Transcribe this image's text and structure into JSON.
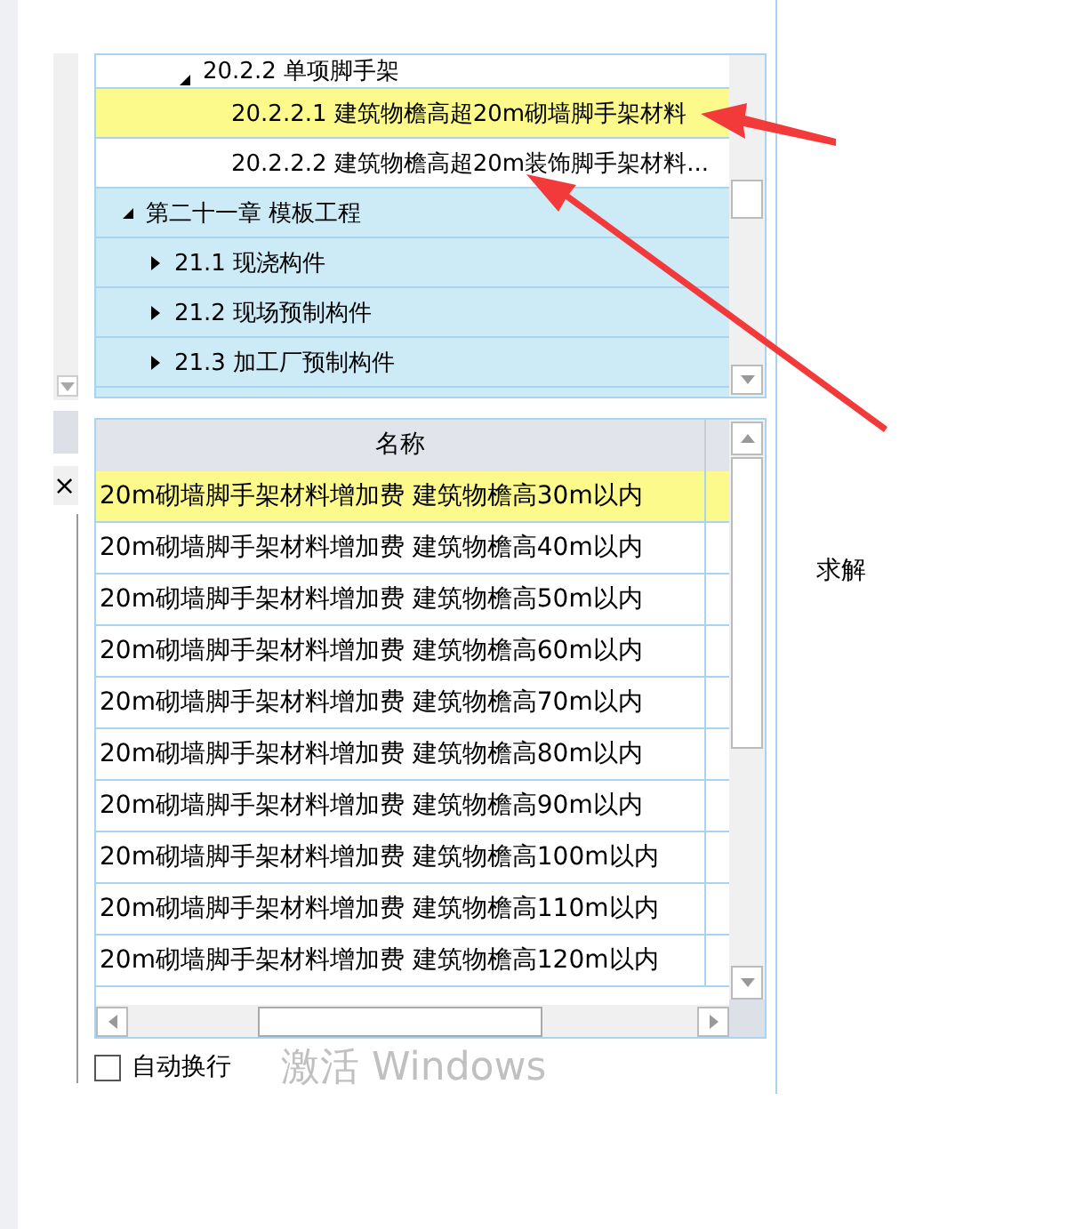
{
  "side": {
    "close": "×"
  },
  "tree": {
    "nodes": [
      {
        "children": [
          {
            "children": [
              {
                "label": "20.2.2 单项脚手架",
                "expanded": true,
                "selected": false,
                "children": [
                  {
                    "label": "20.2.2.1 建筑物檐高超20m砌墙脚手架材料",
                    "selected": true
                  },
                  {
                    "label": "20.2.2.2 建筑物檐高超20m装饰脚手架材料...",
                    "selected": false
                  }
                ]
              }
            ]
          }
        ]
      },
      {
        "label": "第二十一章 模板工程",
        "expanded": true,
        "selected": false,
        "color": "#cdeaf7",
        "children": [
          {
            "label": "21.1 现浇构件",
            "expanded": false,
            "selected": false,
            "color": "#cdeaf7"
          },
          {
            "label": "21.2 现场预制构件",
            "expanded": false,
            "selected": false,
            "color": "#cdeaf7"
          },
          {
            "label": "21.3 加工厂预制构件",
            "expanded": false,
            "selected": false,
            "color": "#cdeaf7"
          }
        ]
      }
    ]
  },
  "table": {
    "columns": [
      "名称"
    ],
    "rows": [
      {
        "name": "20m砌墙脚手架材料增加费  建筑物檐高30m以内",
        "selected": true
      },
      {
        "name": "20m砌墙脚手架材料增加费  建筑物檐高40m以内",
        "selected": false
      },
      {
        "name": "20m砌墙脚手架材料增加费  建筑物檐高50m以内",
        "selected": false
      },
      {
        "name": "20m砌墙脚手架材料增加费  建筑物檐高60m以内",
        "selected": false
      },
      {
        "name": "20m砌墙脚手架材料增加费  建筑物檐高70m以内",
        "selected": false
      },
      {
        "name": "20m砌墙脚手架材料增加费  建筑物檐高80m以内",
        "selected": false
      },
      {
        "name": "20m砌墙脚手架材料增加费  建筑物檐高90m以内",
        "selected": false
      },
      {
        "name": "20m砌墙脚手架材料增加费  建筑物檐高100m以内",
        "selected": false
      },
      {
        "name": "20m砌墙脚手架材料增加费  建筑物檐高110m以内",
        "selected": false
      },
      {
        "name": "20m砌墙脚手架材料增加费  建筑物檐高120m以内",
        "selected": false
      }
    ]
  },
  "wrap_option": {
    "label": "自动换行",
    "checked": false
  },
  "activation_notice": "激活 Windows",
  "solve_label": "求解"
}
